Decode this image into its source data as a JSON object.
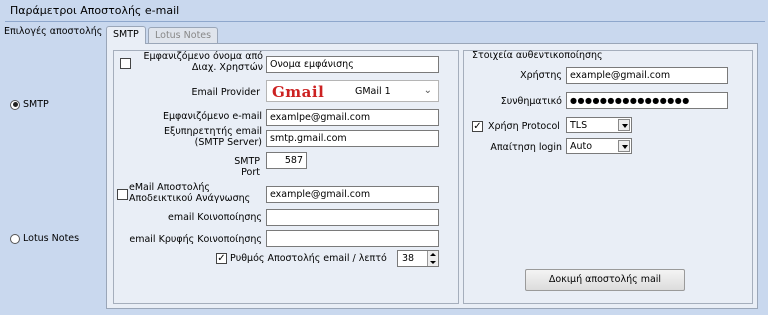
{
  "group": {
    "title": "Παράμετροι Αποστολής e-mail"
  },
  "left": {
    "label": "Επιλογές αποστολής",
    "smtp_radio": "SMTP",
    "lotus_radio": "Lotus Notes"
  },
  "tabs": [
    {
      "label": "SMTP"
    },
    {
      "label": "Lotus Notes"
    }
  ],
  "form": {
    "display_name_label": "Εμφανιζόμενο όνομα από Διαχ. Χρηστών",
    "display_name_value": "Ονομα εμφάνισης",
    "provider_label": "Email Provider",
    "provider_logo": "Gmail",
    "provider_value": "GMail 1",
    "shown_email_label": "Εμφανιζόμενο e-mail",
    "shown_email_value": "examlpe@gmail.com",
    "server_label": "Εξυπηρετητής email (SMTP Server)",
    "server_value": "smtp.gmail.com",
    "port_label": "SMTP Port",
    "port_value": "587",
    "receipt_label": "eMail Αποστολής Αποδεικτικού Ανάγνωσης",
    "receipt_value": "example@gmail.com",
    "cc_label": "email Κοινοποίησης",
    "cc_value": "",
    "bcc_label": "email Κρυφής Κοινοποίησης",
    "bcc_value": "",
    "rate_label": "Ρυθμός Αποστολής email / λεπτό",
    "rate_value": "38"
  },
  "auth": {
    "title": "Στοιχεία αυθεντικοποίησης",
    "user_label": "Χρήστης",
    "user_value": "example@gmail.com",
    "password_label": "Συνθηματικό",
    "password_value": "●●●●●●●●●●●●●●●●",
    "protocol_label": "Χρήση Protocol",
    "protocol_value": "TLS",
    "login_label": "Απαίτηση login",
    "login_value": "Auto",
    "test_button": "Δοκιμή αποστολής mail"
  },
  "colors": {
    "background": "#c9d8ee",
    "panel": "#e9eef6"
  }
}
